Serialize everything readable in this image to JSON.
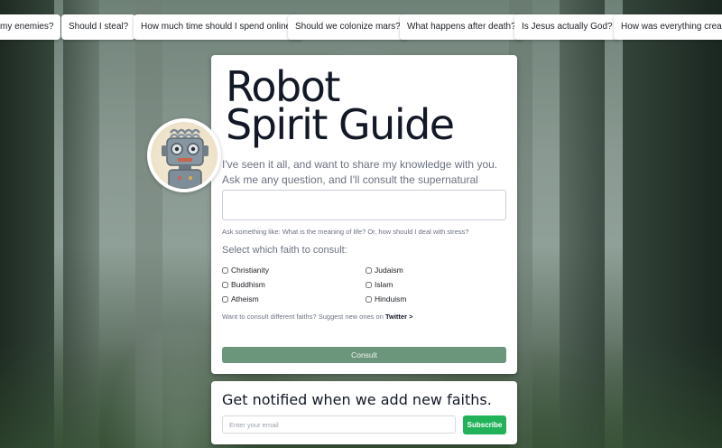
{
  "suggestions": [
    "my enemies?",
    "Should I steal?",
    "How much time should I spend online?",
    "Should we colonize mars?",
    "What happens after death?",
    "Is Jesus actually God?",
    "How was everything created?"
  ],
  "main": {
    "title_line1": "Robot",
    "title_line2": "Spirit Guide",
    "description": "I've seen it all, and want to share my knowledge with you. Ask me any question, and I'll consult the supernatural below.",
    "question_value": "",
    "hint": "Ask something like: What is the meaning of life? Or, how should I deal with stress?",
    "faith_heading": "Select which faith to consult:",
    "faiths": [
      {
        "label": "Christianity",
        "checked": false
      },
      {
        "label": "Judaism",
        "checked": false
      },
      {
        "label": "Buddhism",
        "checked": false
      },
      {
        "label": "Islam",
        "checked": false
      },
      {
        "label": "Atheism",
        "checked": false
      },
      {
        "label": "Hinduism",
        "checked": false
      }
    ],
    "suggest_text": "Want to consult different faiths? Suggest new ones on",
    "twitter_link": "Twitter >",
    "consult_label": "Consult"
  },
  "notify": {
    "title": "Get notified when we add new faiths.",
    "email_placeholder": "Enter your email",
    "email_value": "",
    "subscribe_label": "Subscribe"
  },
  "colors": {
    "consult_button": "#6c967c",
    "subscribe_button": "#22b35a",
    "title_text": "#121826"
  },
  "icons": {
    "avatar": "robot-avatar-icon"
  }
}
